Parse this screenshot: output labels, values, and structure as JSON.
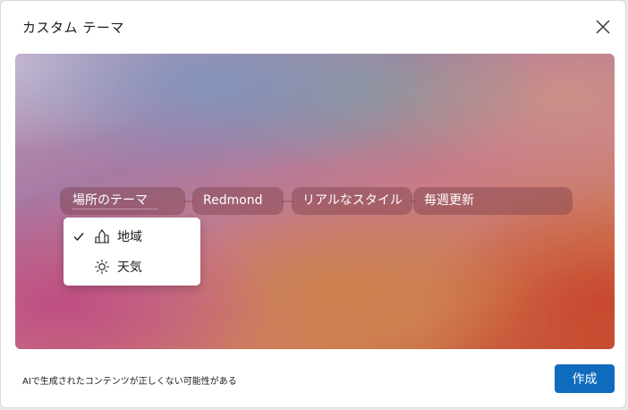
{
  "dialog": {
    "title": "カスタム テーマ",
    "close_icon": "close-icon"
  },
  "preview": {
    "pills": [
      {
        "label": "場所のテーマ"
      },
      {
        "label": "Redmond"
      },
      {
        "label": "リアルなスタイル"
      },
      {
        "label": "毎週更新"
      }
    ],
    "dropdown": {
      "items": [
        {
          "label": "地域",
          "icon": "building-icon",
          "selected": true
        },
        {
          "label": "天気",
          "icon": "sun-icon",
          "selected": false
        }
      ]
    }
  },
  "footer": {
    "disclaimer": "AIで生成されたコンテンツが正しくない可能性がある",
    "create_label": "作成"
  },
  "colors": {
    "accent": "#0f6cbd",
    "pill_bg": "#783c46"
  }
}
